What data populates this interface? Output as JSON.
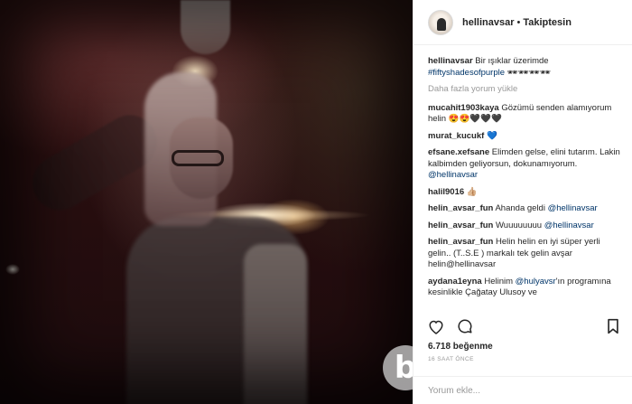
{
  "header": {
    "username": "hellinavsar",
    "separator": "•",
    "follow_status": "Takiptesin"
  },
  "caption": {
    "user": "hellinavsar",
    "text": "Bir ışıklar üzerimde",
    "hashtag": "#fiftyshadesofpurple",
    "emoji": "🕶🕶🕶🕶"
  },
  "load_more": "Daha fazla yorum yükle",
  "comments": [
    {
      "user": "mucahit1903kaya",
      "text": "Gözümü senden alamıyorum helin 😍😍🖤🖤🖤",
      "mention": ""
    },
    {
      "user": "murat_kucukf",
      "text": "💙",
      "mention": ""
    },
    {
      "user": "efsane.xefsane",
      "text": "Elimden gelse, elini tutarım. Lakin kalbimden geliyorsun, dokunamıyorum.",
      "mention": "@hellinavsar"
    },
    {
      "user": "halil9016",
      "text": "👍🏼",
      "mention": ""
    },
    {
      "user": "helin_avsar_fun",
      "text": "Ahanda geldi",
      "mention": "@hellinavsar"
    },
    {
      "user": "helin_avsar_fun",
      "text": "Wuuuuuuuu",
      "mention": "@hellinavsar"
    },
    {
      "user": "helin_avsar_fun",
      "text": "Helin helin en iyi süper yerli gelin.. (T..S.E ) markalı tek gelin avşar helin@hellinavsar",
      "mention": ""
    },
    {
      "user": "aydana1eyna",
      "text": "Helinim",
      "mention": "@hulyavsr",
      "text2": "'ın programına kesinlikle Çağatay Ulusoy ve"
    }
  ],
  "likes": "6.718 beğenme",
  "time": "16 SAAT ÖNCE",
  "add_comment_placeholder": "Yorum ekle...",
  "watermark_letter": "b",
  "icons": [
    "heart-icon",
    "comment-icon",
    "bookmark-icon",
    "more-options-icon"
  ]
}
